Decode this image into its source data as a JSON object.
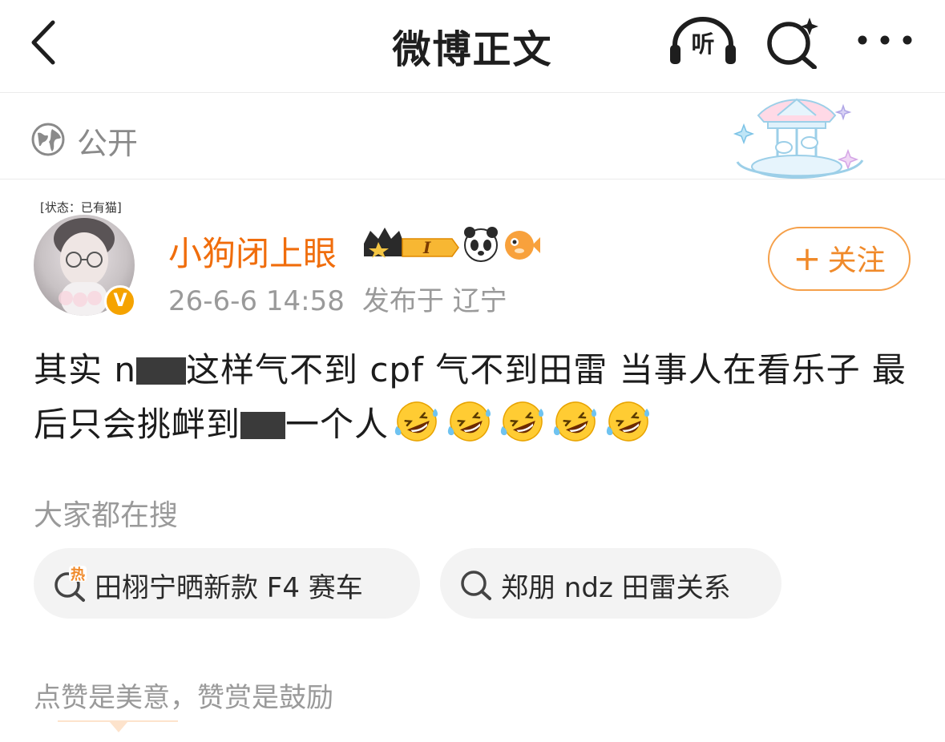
{
  "header": {
    "title": "微博正文",
    "listen_label": "听"
  },
  "visibility": {
    "label": "公开"
  },
  "author": {
    "status_tag": "[状态：已有猫]",
    "name": "小狗闭上眼",
    "verified_badge": "V",
    "time": "26-6-6 14:58",
    "location": "发布于 辽宁",
    "follow_label": "关注",
    "follow_plus": "+"
  },
  "post": {
    "part1": "其实 n",
    "part2": "这样气不到 cpf 气不到田雷 当事人在看乐子 最后只会挑衅到",
    "part3": "一个人",
    "emoji_count": 5
  },
  "searches": {
    "heading": "大家都在搜",
    "items": [
      {
        "label": "田栩宁晒新款 F4 赛车",
        "icon": "hot-search-icon"
      },
      {
        "label": "郑朋 ndz 田雷关系",
        "icon": "search-icon"
      }
    ]
  },
  "reward": {
    "text": "点赞是美意，赞赏是鼓励"
  },
  "colors": {
    "accent": "#f06d0c",
    "follow_border": "#f5a04a",
    "muted": "#9a9a9a",
    "chip_bg": "#f3f3f3"
  }
}
